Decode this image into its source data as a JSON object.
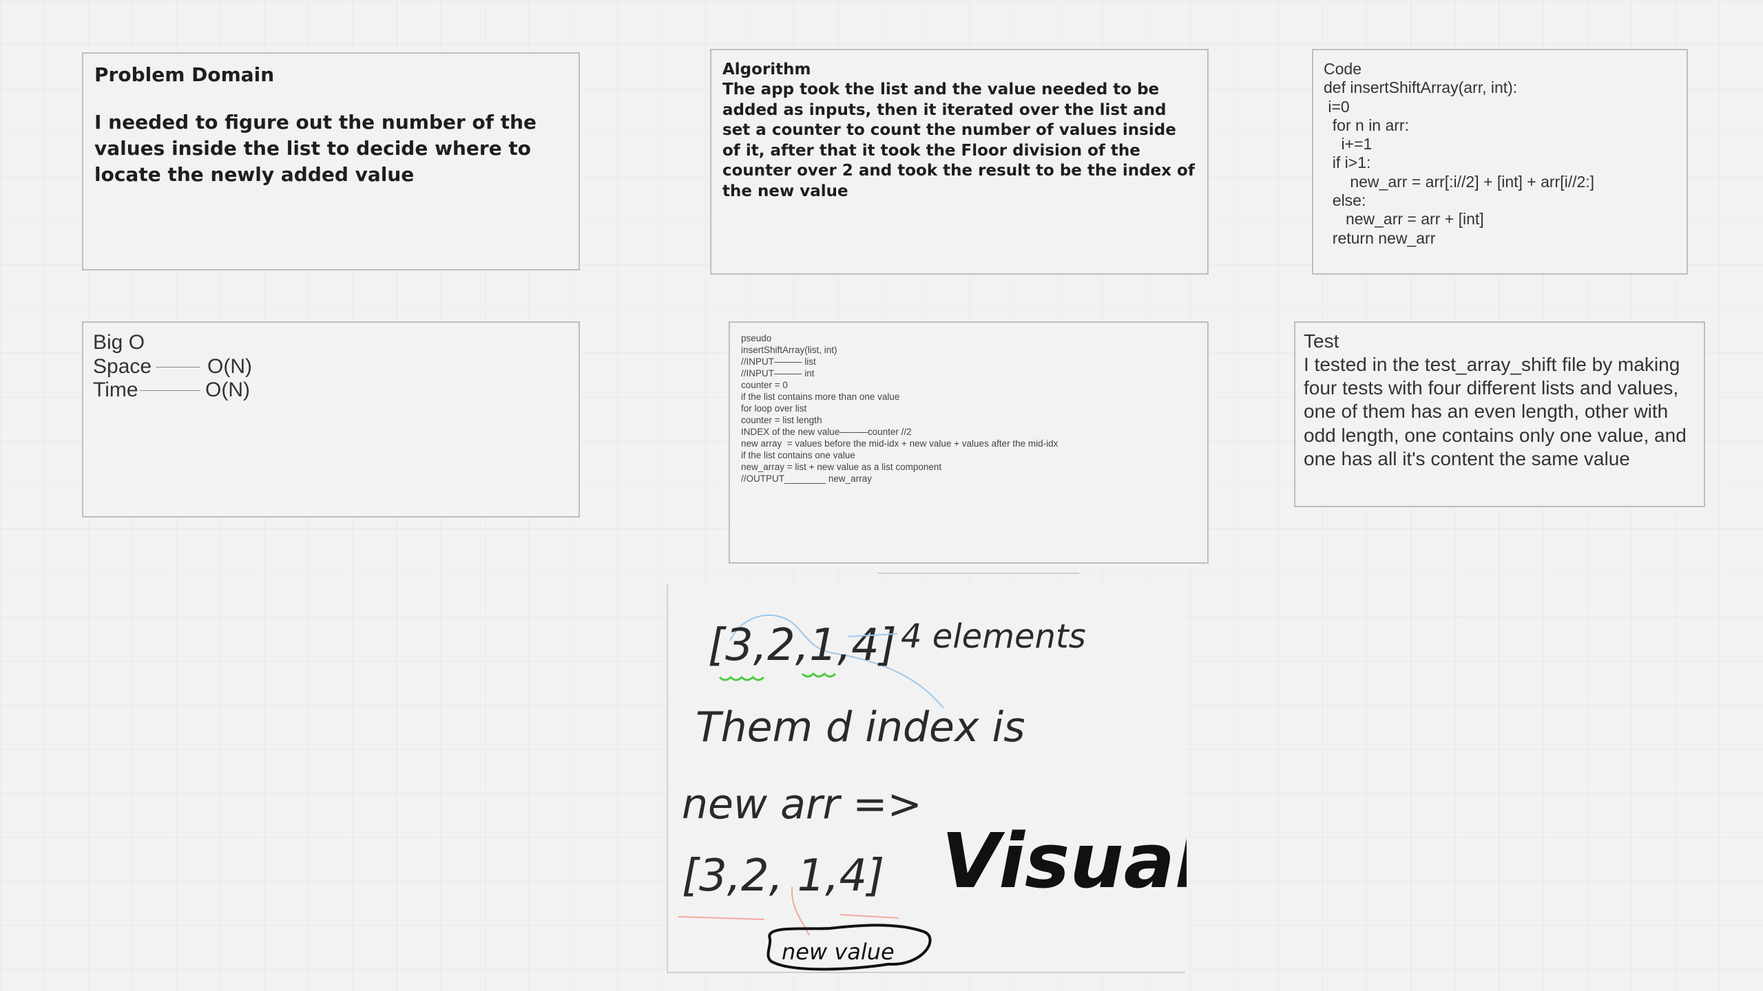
{
  "problem_domain": {
    "title": "Problem Domain",
    "body": "I needed to figure out the number of the values inside the list to decide where to locate the newly added value"
  },
  "algorithm": {
    "title": "Algorithm",
    "body": "The app took the list and the value needed to be added as inputs, then it iterated over the list and set a counter to count the number of values inside of it, after that it took the Floor division of the counter over 2 and took the result to be the index of the new value"
  },
  "code": {
    "lines": [
      "Code",
      "def insertShiftArray(arr, int):",
      " i=0",
      "  for n in arr:",
      "    i+=1",
      "  if i>1:",
      "      new_arr = arr[:i//2] + [int] + arr[i//2:]",
      "  else:",
      "     new_arr = arr + [int]",
      "  return new_arr"
    ]
  },
  "big_o": {
    "title": "Big O",
    "space_label": "Space",
    "space_value": "O(N)",
    "time_label": "Time",
    "time_value": "O(N)"
  },
  "pseudo": {
    "lines": [
      "pseudo",
      "insertShiftArray(list, int)",
      "//INPUT——— list",
      "//INPUT——— int",
      "counter = 0",
      "if the list contains more than one value",
      "for loop over list",
      "counter = list length",
      "INDEX of the new value———counter //2",
      "new array  = values before the mid-idx + new value + values after the mid-idx",
      "if the list contains one value",
      "new_array = list + new value as a list component",
      "",
      "//OUTPUT________ new_array"
    ]
  },
  "test": {
    "title": "Test",
    "body": "I tested in the test_array_shift file by making four tests with four different lists and values, one of them has an even length, other with odd length, one contains only one value, and one has all it's content the same value"
  },
  "visual": {
    "label": "Visual",
    "note_count": "4 elements",
    "note_index": "Them d index is",
    "note_newarr": "new arr =>",
    "list_before": "[3,2,1,4]",
    "list_after": "[3,2, 1,4]",
    "bubble": "new value"
  }
}
